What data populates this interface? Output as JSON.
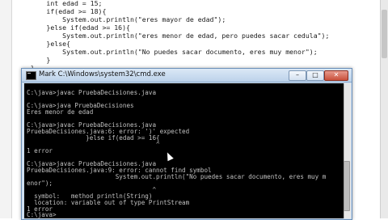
{
  "editor": {
    "lines": [
      "        int edad = 15;",
      "        if(edad >= 18){",
      "            System.out.println(\"eres mayor de edad\");",
      "        }else if(edad >= 16){",
      "            System.out.println(\"eres menor de edad, pero puedes sacar cedula\");",
      "        }else{",
      "            System.out.println(\"No puedes sacar documento, eres muy menor\");",
      "        }",
      "    }",
      "}"
    ]
  },
  "cmd": {
    "title": "Mark C:\\Windows\\system32\\cmd.exe",
    "minimize": "–",
    "maximize": "□",
    "close": "✕",
    "lines": [
      "",
      "C:\\java>javac PruebaDecisiones.java",
      "",
      "C:\\java>java PruebaDecisiones",
      "Eres menor de edad",
      "",
      "C:\\java>javac PruebaDecisiones.java",
      "PruebaDecisiones.java:6: error: ')' expected",
      "                }else if(edad >= 16{",
      "                                   ^",
      "1 error",
      "",
      "C:\\java>javac PruebaDecisiones.java",
      "PruebaDecisiones.java:9: error: cannot find symbol",
      "                        System.out.println(\"No puedes sacar documento, eres muy m",
      "enor\");",
      "                                  ^",
      "  symbol:   method println(String)",
      "  location: variable out of type PrintStream",
      "1 error",
      "",
      "C:\\java>"
    ]
  }
}
